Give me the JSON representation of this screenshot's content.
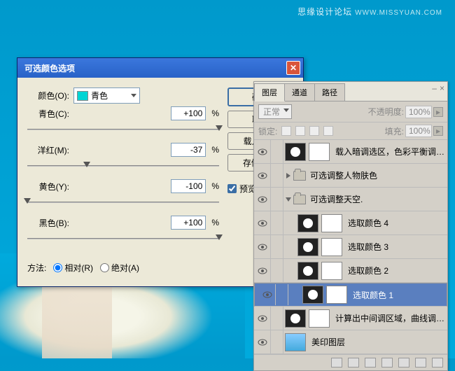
{
  "watermark": {
    "text": "思缘设计论坛",
    "url": "WWW.MISSYUAN.COM"
  },
  "dialog": {
    "title": "可选颜色选项",
    "color_label": "颜色(O):",
    "color_value": "青色",
    "sliders": [
      {
        "label": "青色(C):",
        "value": "+100",
        "pos": 100
      },
      {
        "label": "洋红(M):",
        "value": "-37",
        "pos": 31
      },
      {
        "label": "黄色(Y):",
        "value": "-100",
        "pos": 0
      },
      {
        "label": "黑色(B):",
        "value": "+100",
        "pos": 100
      }
    ],
    "pct": "%",
    "method_label": "方法:",
    "method_rel": "相对(R)",
    "method_abs": "绝对(A)",
    "ok": "确定",
    "cancel": "取消",
    "load": "载入(L)...",
    "save": "存储(S)...",
    "preview": "预览(P)"
  },
  "panel": {
    "tabs": [
      "图层",
      "通道",
      "路径"
    ],
    "blend": "正常",
    "opacity_label": "不透明度:",
    "opacity": "100%",
    "lock_label": "锁定:",
    "fill_label": "填充:",
    "fill": "100%",
    "layers": [
      {
        "type": "adj",
        "name": "载入暗调选区，色彩平衡调整..."
      },
      {
        "type": "group",
        "name": "可选调整人物肤色",
        "open": false
      },
      {
        "type": "group",
        "name": "可选调整天空.",
        "open": true
      },
      {
        "type": "adj",
        "name": "选取颜色 4",
        "indent": 1
      },
      {
        "type": "adj",
        "name": "选取颜色 3",
        "indent": 1
      },
      {
        "type": "adj",
        "name": "选取颜色 2",
        "indent": 1
      },
      {
        "type": "adj",
        "name": "选取颜色 1",
        "indent": 1,
        "selected": true
      },
      {
        "type": "adj",
        "name": "计算出中间调区域，曲线调整..."
      },
      {
        "type": "img",
        "name": "美印图层"
      }
    ]
  }
}
